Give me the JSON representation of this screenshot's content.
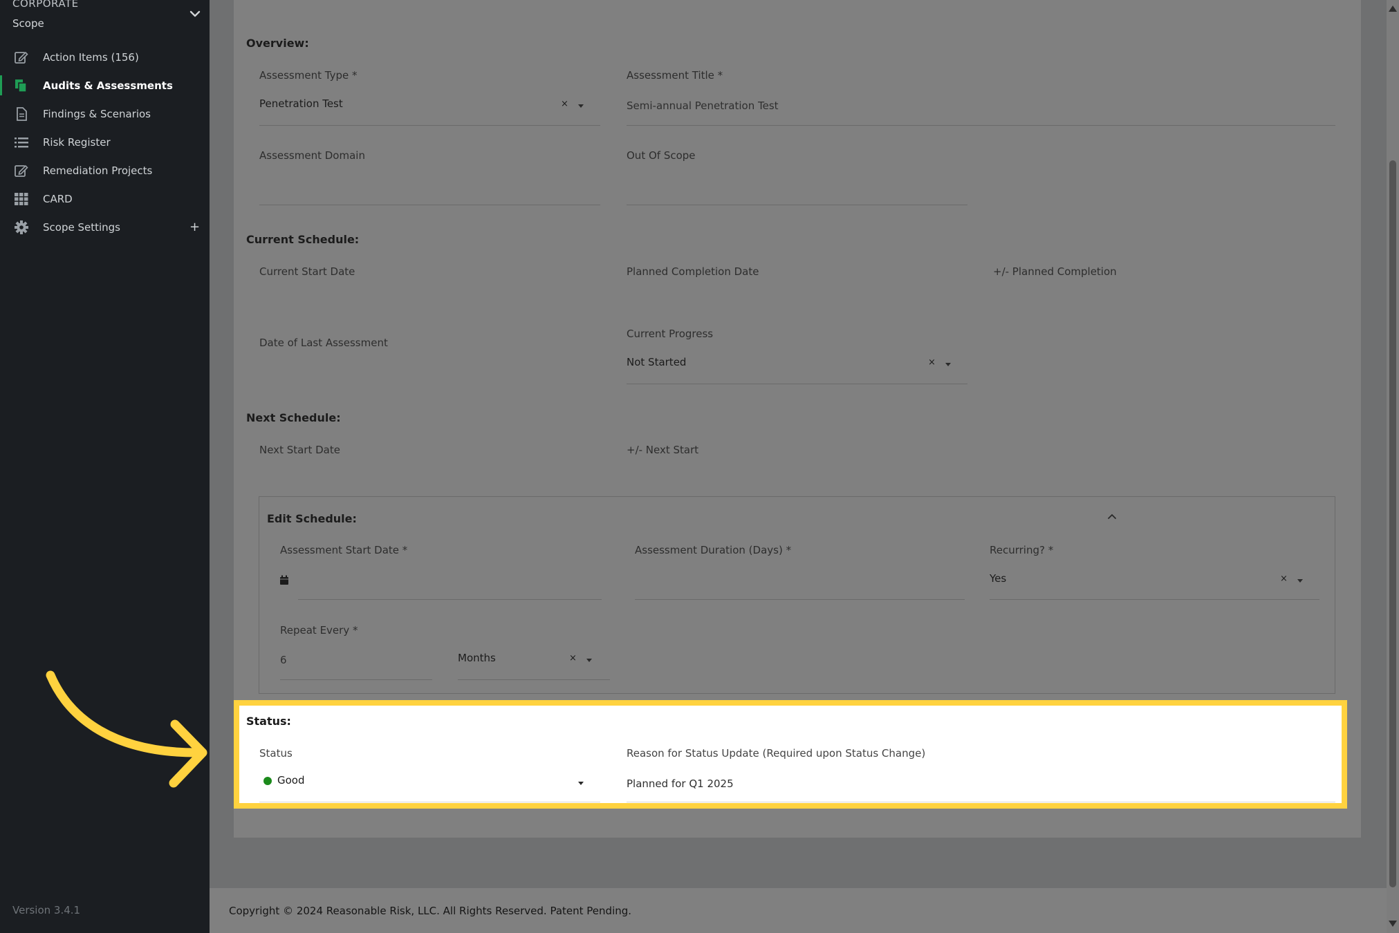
{
  "sidebar": {
    "org": "CORPORATE",
    "scope": "Scope",
    "items": [
      {
        "label": "Action Items (156)",
        "icon": "edit-icon"
      },
      {
        "label": "Audits & Assessments",
        "icon": "copy-icon",
        "active": true
      },
      {
        "label": "Findings & Scenarios",
        "icon": "document-icon"
      },
      {
        "label": "Risk Register",
        "icon": "list-icon"
      },
      {
        "label": "Remediation Projects",
        "icon": "edit-icon"
      },
      {
        "label": "CARD",
        "icon": "grid-icon"
      },
      {
        "label": "Scope Settings",
        "icon": "gear-icon"
      }
    ],
    "plus": "+",
    "version": "Version 3.4.1"
  },
  "overview": {
    "heading": "Overview:",
    "assessment_type_label": "Assessment Type *",
    "assessment_type_value": "Penetration Test",
    "assessment_title_label": "Assessment Title *",
    "assessment_title_value": "Semi-annual Penetration Test",
    "assessment_domain_label": "Assessment Domain",
    "out_of_scope_label": "Out Of Scope"
  },
  "current_schedule": {
    "heading": "Current Schedule:",
    "current_start_label": "Current Start Date",
    "planned_completion_label": "Planned Completion Date",
    "plus_minus_completion_label": "+/- Planned Completion",
    "last_assessment_label": "Date of Last Assessment",
    "current_progress_label": "Current Progress",
    "current_progress_value": "Not Started"
  },
  "next_schedule": {
    "heading": "Next Schedule:",
    "next_start_label": "Next Start Date",
    "plus_minus_next_label": "+/- Next Start"
  },
  "edit_schedule": {
    "heading": "Edit Schedule:",
    "start_date_label": "Assessment Start Date *",
    "duration_label": "Assessment Duration (Days) *",
    "recurring_label": "Recurring? *",
    "recurring_value": "Yes",
    "repeat_label": "Repeat Every *",
    "repeat_value": "6",
    "repeat_unit": "Months"
  },
  "status": {
    "heading": "Status:",
    "status_label": "Status",
    "status_value": "Good",
    "status_color": "#1b8a1b",
    "reason_label": "Reason for Status Update (Required upon Status Change)",
    "reason_value": "Planned for Q1 2025"
  },
  "clear_glyph": "×",
  "footer": {
    "copyright": "Copyright © 2024 Reasonable Risk, LLC. All Rights Reserved. Patent Pending."
  },
  "colors": {
    "highlight": "#ffd23f",
    "sidebar_bg": "#1b1e22",
    "active_accent": "#1f9d55"
  }
}
